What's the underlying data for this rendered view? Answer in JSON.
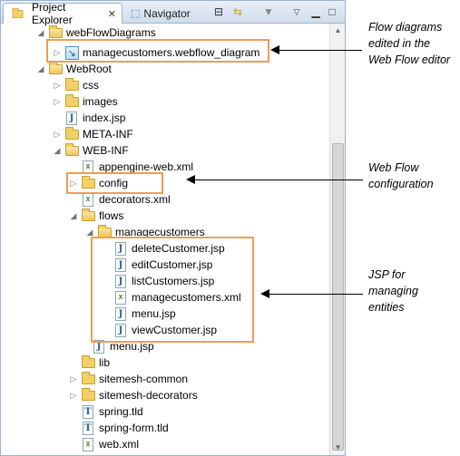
{
  "tabs": {
    "project_explorer": "Project Explorer",
    "close": "✕",
    "navigator": "Navigator"
  },
  "tree": {
    "webflowdiagrams": "webFlowDiagrams",
    "managecustomers_diagram": "managecustomers.webflow_diagram",
    "webroot": "WebRoot",
    "css": "css",
    "images": "images",
    "index_jsp": "index.jsp",
    "meta_inf": "META-INF",
    "web_inf": "WEB-INF",
    "appengine_web_xml": "appengine-web.xml",
    "config": "config",
    "decorators_xml": "decorators.xml",
    "flows": "flows",
    "managecustomers": "managecustomers",
    "deletecustomer_jsp": "deleteCustomer.jsp",
    "editcustomer_jsp": "editCustomer.jsp",
    "listcustomers_jsp": "listCustomers.jsp",
    "managecustomers_xml": "managecustomers.xml",
    "menu_jsp_inner": "menu.jsp",
    "viewcustomer_jsp": "viewCustomer.jsp",
    "menu_jsp_outer": "menu.jsp",
    "lib": "lib",
    "sitemesh_common": "sitemesh-common",
    "sitemesh_decorators": "sitemesh-decorators",
    "spring_tld": "spring.tld",
    "spring_form_tld": "spring-form.tld",
    "web_xml": "web.xml"
  },
  "callouts": {
    "flow_diagrams": [
      "Flow diagrams",
      "edited in the",
      "Web Flow editor"
    ],
    "web_flow_config": [
      "Web Flow",
      "configuration"
    ],
    "jsp": [
      "JSP for",
      "managing",
      "entities"
    ]
  },
  "colors": {
    "highlight": "#f29b52",
    "panel_border": "#99b4d1"
  }
}
